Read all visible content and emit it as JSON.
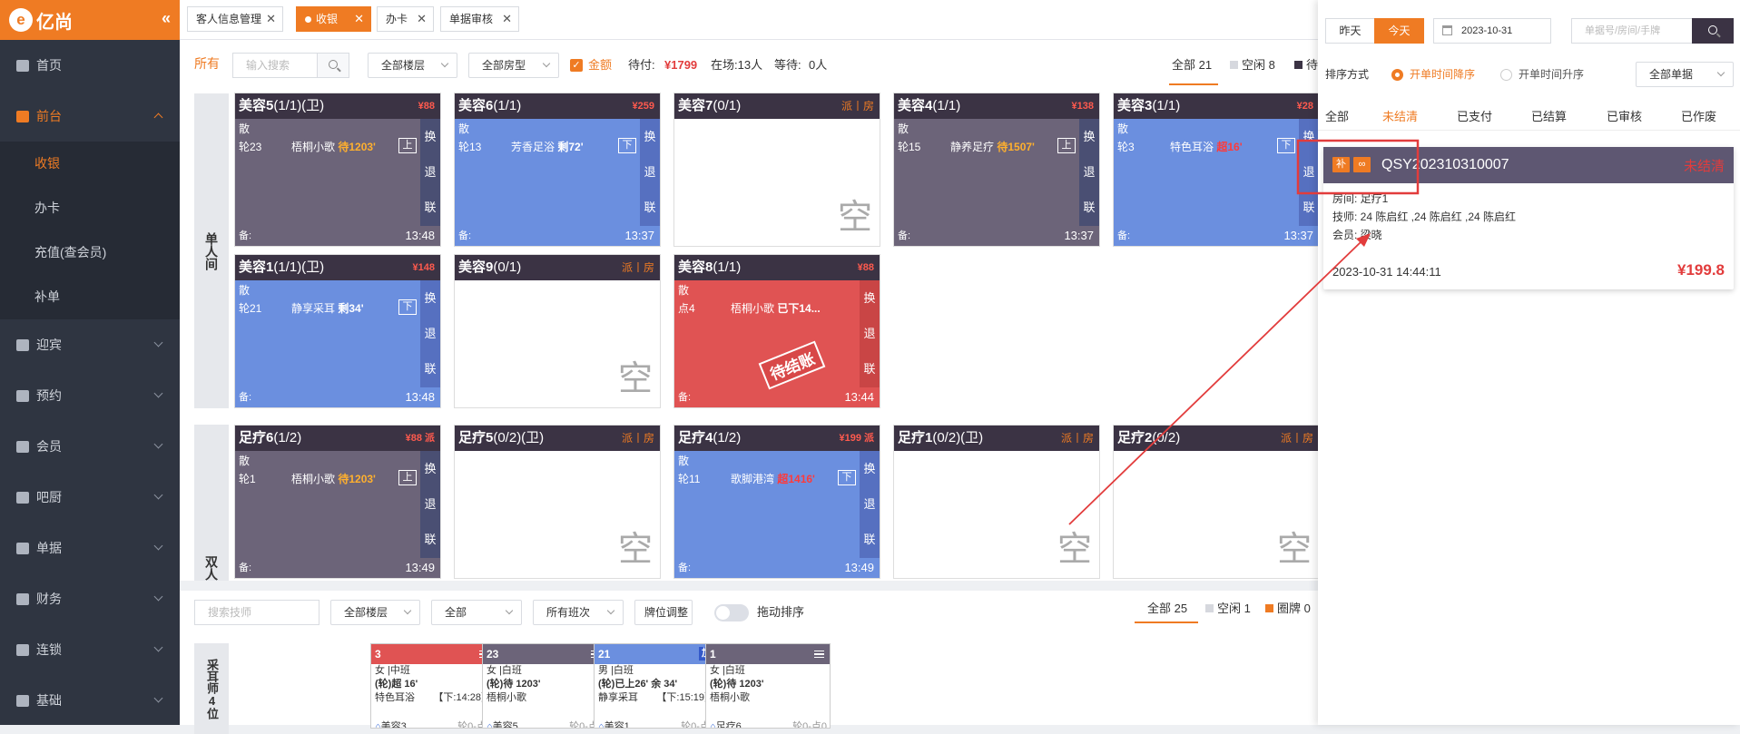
{
  "app": {
    "logo": "亿尚",
    "logo_mark": "e"
  },
  "sidebar": {
    "items": [
      {
        "id": "home",
        "label": "首页",
        "icon": "home-icon"
      },
      {
        "id": "front",
        "label": "前台",
        "icon": "monitor-icon",
        "active": true,
        "sub": [
          "收银",
          "办卡",
          "充值(查会员)",
          "补单"
        ]
      },
      {
        "id": "welcome",
        "label": "迎宾",
        "icon": "people-icon"
      },
      {
        "id": "reserve",
        "label": "预约",
        "icon": "calendar-icon"
      },
      {
        "id": "member",
        "label": "会员",
        "icon": "user-icon"
      },
      {
        "id": "bar",
        "label": "吧厨",
        "icon": "kitchen-icon"
      },
      {
        "id": "bills",
        "label": "单据",
        "icon": "document-icon"
      },
      {
        "id": "finance",
        "label": "财务",
        "icon": "finance-icon"
      },
      {
        "id": "chain",
        "label": "连锁",
        "icon": "cube-icon"
      },
      {
        "id": "base",
        "label": "基础",
        "icon": "settings-icon"
      }
    ],
    "sub_active": "收银"
  },
  "tabs": [
    {
      "label": "客人信息管理"
    },
    {
      "label": "收银",
      "active": true
    },
    {
      "label": "办卡"
    },
    {
      "label": "单据审核"
    }
  ],
  "filters": {
    "all": "所有",
    "search_placeholder": "输入搜索",
    "floor": "全部楼层",
    "roomtype": "全部房型",
    "amount_label": "金额",
    "waitpay_label": "待付:",
    "waitpay_value": "¥1799",
    "onsite": "在场:13人",
    "waiting_label": "等待:",
    "waiting_value": "0人",
    "right_all": "全部 21",
    "right_idle": "空闲 8",
    "right_more": "待"
  },
  "rows": [
    {
      "label": "单人间"
    },
    {
      "label": "双人"
    }
  ],
  "rooms": [
    {
      "name": "美容5",
      "count": "(1/1)(卫)",
      "price": "¥88",
      "style": "gray",
      "type": "散",
      "code": "轮23",
      "service": "梧桐小歌",
      "status": "待1203'",
      "status_color": "o",
      "updown": "上",
      "note": "备:",
      "time": "13:48"
    },
    {
      "name": "美容6",
      "count": "(1/1)",
      "price": "¥259",
      "style": "blue",
      "type": "散",
      "code": "轮13",
      "service": "芳香足浴",
      "status": "剩72'",
      "status_color": "w",
      "updown": "下",
      "note": "备:",
      "time": "13:37"
    },
    {
      "name": "美容7",
      "count": "(0/1)",
      "price": "派丨房",
      "style": "empty",
      "empty": "空"
    },
    {
      "name": "美容4",
      "count": "(1/1)",
      "price": "¥138",
      "style": "gray",
      "type": "散",
      "code": "轮15",
      "service": "静养足疗",
      "status": "待1507'",
      "status_color": "o",
      "updown": "上",
      "note": "备:",
      "time": "13:37"
    },
    {
      "name": "美容3",
      "count": "(1/1)",
      "price": "¥28",
      "style": "blue",
      "type": "散",
      "code": "轮3",
      "service": "特色耳浴",
      "status": "超16'",
      "status_color": "r",
      "updown": "下",
      "note": "备:",
      "time": "13:37"
    },
    {
      "name": "美容1",
      "count": "(1/1)(卫)",
      "price": "¥148",
      "style": "blue",
      "type": "散",
      "code": "轮21",
      "service": "静享采耳",
      "status": "剩34'",
      "status_color": "w",
      "updown": "下",
      "note": "备:",
      "time": "13:48"
    },
    {
      "name": "美容9",
      "count": "(0/1)",
      "price": "派丨房",
      "style": "empty",
      "empty": "空"
    },
    {
      "name": "美容8",
      "count": "(1/1)",
      "price": "¥88",
      "style": "red",
      "type": "散",
      "code": "点4",
      "service": "梧桐小歌",
      "status": "已下14...",
      "status_color": "w",
      "note": "备:",
      "time": "13:44",
      "stamp": "待结账"
    },
    {
      "name": "足疗6",
      "count": "(1/2)",
      "price": "¥88 派",
      "style": "gray",
      "type": "散",
      "code": "轮1",
      "service": "梧桐小歌",
      "status": "待1203'",
      "status_color": "o",
      "updown": "上",
      "note": "备:",
      "time": "13:49"
    },
    {
      "name": "足疗5",
      "count": "(0/2)(卫)",
      "price": "派丨房",
      "style": "empty",
      "empty": "空"
    },
    {
      "name": "足疗4",
      "count": "(1/2)",
      "price": "¥199 派",
      "style": "blue",
      "type": "散",
      "code": "轮11",
      "service": "歌脚港湾",
      "status": "超1416'",
      "status_color": "r",
      "updown": "下",
      "note": "备:",
      "time": "13:49"
    },
    {
      "name": "足疗1",
      "count": "(0/2)(卫)",
      "price": "派丨房",
      "style": "empty",
      "empty": "空"
    },
    {
      "name": "足疗2",
      "count": "(0/2)",
      "price": "派丨房",
      "style": "empty",
      "empty": "空"
    }
  ],
  "side_actions": [
    "换",
    "退",
    "联"
  ],
  "tech_bar": {
    "search_placeholder": "搜索技师",
    "floor": "全部楼层",
    "all": "全部",
    "shift": "所有班次",
    "adjust": "牌位调整",
    "drag": "拖动排序",
    "right_all": "全部 25",
    "right_idle": "空闲 1",
    "right_circle": "圈牌 0"
  },
  "tech_group": "采耳师4位",
  "techs": [
    {
      "num": "3",
      "color": "#e05353",
      "l1": "女 |中班",
      "l2": "(轮)超 16'",
      "l3": "特色耳浴",
      "l3r": "【下:14:28】",
      "room": "美容3",
      "rr": "轮0-点0"
    },
    {
      "num": "23",
      "color": "#6c6479",
      "l1": "女 |白班",
      "l2": "(轮)待 1203'",
      "l3": "梧桐小歌",
      "l3r": "",
      "room": "美容5",
      "rr": "轮0-点0"
    },
    {
      "num": "21",
      "color": "#6b8fdf",
      "badge": "加",
      "l1": "男 |白班",
      "l2": "(轮)已上26' 余 34'",
      "l3": "静享采耳",
      "l3r": "【下:15:19】",
      "room": "美容1",
      "rr": "轮0-点0"
    },
    {
      "num": "1",
      "color": "#6c6479",
      "l1": "女 |白班",
      "l2": "(轮)待 1203'",
      "l3": "梧桐小歌",
      "l3r": "",
      "room": "足疗6",
      "rr": "轮0-点0"
    }
  ],
  "panel": {
    "yesterday": "昨天",
    "today": "今天",
    "date": "2023-10-31",
    "search_placeholder": "单据号/房间/手牌",
    "sort_label": "排序方式",
    "sort_desc": "开单时间降序",
    "sort_asc": "开单时间升序",
    "doc_filter": "全部单据",
    "tabs": [
      "全部",
      "未结清",
      "已支付",
      "已结算",
      "已审核",
      "已作废"
    ],
    "active_tab": "未结清",
    "order": {
      "badge1": "补",
      "badge2": "∞",
      "no": "QSY202310310007",
      "status": "未结清",
      "room": "房间: 足疗1",
      "tech": "技师: 24 陈启红 ,24 陈启红 ,24 陈启红",
      "member": "会员: 梁晓",
      "date": "2023-10-31 14:44:11",
      "amount": "¥199.8"
    }
  },
  "colors": {
    "accent": "#ef7b23",
    "sidebar": "#2f3541",
    "card_gray": "#6c6479",
    "card_blue": "#6b8fdf",
    "card_red": "#e05353",
    "annotation": "#e23c3c"
  }
}
